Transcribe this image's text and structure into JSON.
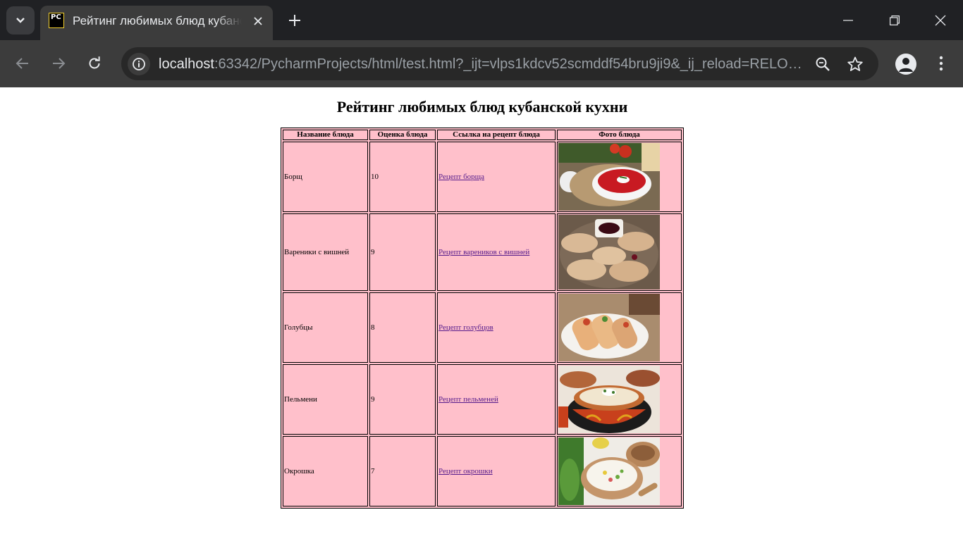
{
  "browser": {
    "tab_title": "Рейтинг любимых блюд кубанской кухни",
    "url_host": "localhost",
    "url_rest": ":63342/PycharmProjects/html/test.html?_ijt=vlps1kdcv52scmddf54bru9ji9&_ij_reload=RELOAD_ON_SAVE",
    "favicon_text": "PC",
    "icons": [
      "tab-search-icon",
      "close-icon",
      "plus-icon",
      "minimize-icon",
      "restore-icon",
      "close-window-icon",
      "back-icon",
      "forward-icon",
      "reload-icon",
      "info-icon",
      "zoom-icon",
      "star-icon",
      "profile-icon",
      "menu-icon"
    ]
  },
  "page": {
    "title": "Рейтинг любимых блюд кубанской кухни",
    "table": {
      "headers": [
        "Название блюда",
        "Оценка блюда",
        "Ссылка на рецепт блюда",
        "Фото блюда"
      ],
      "rows": [
        {
          "name": "Борщ",
          "rating": "10",
          "link": "Рецепт борща",
          "photo": "borscht-photo"
        },
        {
          "name": "Вареники с вишней",
          "rating": "9",
          "link": "Рецепт вареников с вишней",
          "photo": "vareniki-photo"
        },
        {
          "name": "Голубцы",
          "rating": "8",
          "link": "Рецепт голубцов",
          "photo": "golubtsy-photo"
        },
        {
          "name": "Пельмени",
          "rating": "9",
          "link": "Рецепт пельменей",
          "photo": "pelmeni-photo"
        },
        {
          "name": "Окрошка",
          "rating": "7",
          "link": "Рецепт окрошки",
          "photo": "okroshka-photo"
        }
      ]
    }
  },
  "colors": {
    "table_background": "#ffc0cb",
    "link": "#551a8b",
    "chrome_dark": "#202124",
    "chrome_toolbar": "#3c3c3c"
  }
}
